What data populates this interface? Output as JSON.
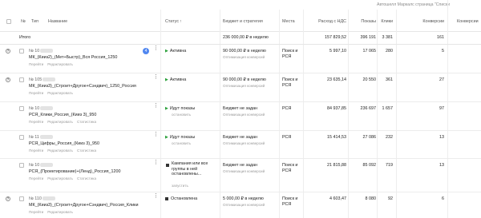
{
  "breadcrumb": "Автошелл Маркалс страница \"Списки",
  "columns": {
    "no": "№",
    "type": "Тип",
    "name": "Название",
    "status": "Статус",
    "status_sort": "↑",
    "budget": "Бюджет и стратегия",
    "places": "Места",
    "spend": "Расход с НДС",
    "impressions": "Показы",
    "clicks": "Клики",
    "conversions": "Конверсии",
    "conversions2": "Конверсии"
  },
  "total": {
    "label": "Итого",
    "budget": "236 000,00 ₽ в неделю",
    "spend": "157 829,52",
    "impressions": "396 191",
    "clicks": "3 381",
    "conversions": "161"
  },
  "rows": [
    {
      "id": "№ 10",
      "name": "МК_(Кииз2)_(Мет+Быстр)_Вся Россия_1250",
      "links": [
        "Перейти",
        "Редактировать"
      ],
      "badge": "4",
      "status_label": "Активна",
      "status_kind": "active",
      "status_sub": "",
      "budget": "90 000,00 ₽ в неделю",
      "budget_sub": "Оптимизация конверсий",
      "places": "Поиск и РСЯ",
      "spend": "5 997,10",
      "impressions": "17 065",
      "clicks": "280",
      "conversions": "5"
    },
    {
      "id": "№ 105",
      "name": "МК_(Кииз3)_(Строит+Другое+Сэндвич)_1250_Россия",
      "links": [
        "Перейти",
        "Редактировать"
      ],
      "badge": "",
      "status_label": "Активна",
      "status_kind": "active",
      "status_sub": "",
      "budget": "90 000,00 ₽ в неделю",
      "budget_sub": "Оптимизация конверсий",
      "places": "Поиск и РСЯ",
      "spend": "23 635,14",
      "impressions": "20 550",
      "clicks": "361",
      "conversions": "27"
    },
    {
      "id": "№ 10",
      "name": "РСЯ_Клики_Россия_(Кииз 3)_950",
      "links": [
        "Перейти",
        "Редактировать",
        "Статистика"
      ],
      "badge": "",
      "status_label": "Идут показы",
      "status_kind": "showing",
      "status_sub": "остановить",
      "budget": "Бюджет не задан",
      "budget_sub": "Оптимизация конверсий",
      "places": "РСЯ",
      "spend": "84 937,85",
      "impressions": "236 697",
      "clicks": "1 657",
      "conversions": "97"
    },
    {
      "id": "№ 11",
      "name": "РСЯ_Цифры_Россия_(Кииз 3)_950",
      "links": [
        "Перейти",
        "Редактировать",
        "Статистика"
      ],
      "badge": "",
      "status_label": "Идут показы",
      "status_kind": "showing",
      "status_sub": "остановить",
      "budget": "Бюджет не задан",
      "budget_sub": "Оптимизация конверсий",
      "places": "РСЯ",
      "spend": "15 414,53",
      "impressions": "27 086",
      "clicks": "232",
      "conversions": "13"
    },
    {
      "id": "№ 10",
      "name": "РСЯ_(Проектирование)+(Ленд)_Россия_1200",
      "links": [
        "Перейти",
        "Редактировать",
        "Статистика"
      ],
      "badge": "",
      "status_label": "Кампания или все группы в ней остановлены...",
      "status_kind": "stopped_multi",
      "status_sub": "запустить",
      "budget": "Бюджет не задан",
      "budget_sub": "Оптимизация конверсий",
      "places": "Поиск и РСЯ",
      "spend": "21 815,88",
      "impressions": "85 092",
      "clicks": "719",
      "conversions": "13"
    },
    {
      "id": "№ 110",
      "name": "МК_(Кииз3)_(Строит+Другое+Сэндвич)_Россия_Клики",
      "links": [
        "Перейти",
        "Редактировать"
      ],
      "badge": "",
      "status_label": "Остановлена",
      "status_kind": "stopped",
      "status_sub": "",
      "budget": "5 000,00 ₽ в неделю",
      "budget_sub": "Оптимизация конверсий",
      "places": "Поиск и РСЯ",
      "spend": "4 603,47",
      "impressions": "8 080",
      "clicks": "92",
      "conversions": "6"
    }
  ]
}
